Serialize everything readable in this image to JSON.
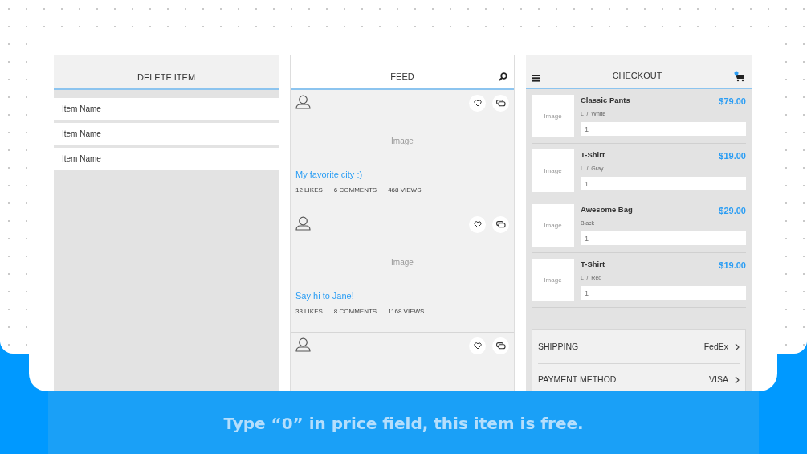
{
  "delete_screen": {
    "title": "DELETE ITEM",
    "items": [
      {
        "label": "Item Name"
      },
      {
        "label": "Item Name"
      },
      {
        "label": "Item Name"
      }
    ]
  },
  "feed_screen": {
    "title": "FEED",
    "posts": [
      {
        "kind": "full",
        "image_label": "Image",
        "caption": "My favorite city :)",
        "likes": "12 LIKES",
        "comments": "6 COMMENTS",
        "views": "468 VIEWS"
      },
      {
        "kind": "full",
        "image_label": "Image",
        "caption": "Say hi to Jane!",
        "likes": "33 LIKES",
        "comments": "8 COMMENTS",
        "views": "1168 VIEWS"
      },
      {
        "kind": "cut_off"
      }
    ]
  },
  "checkout_screen": {
    "title": "CHECKOUT",
    "items": [
      {
        "image_label": "Image",
        "name": "Classic Pants",
        "price": "$79.00",
        "variant": "L  /  White",
        "quantity": "1"
      },
      {
        "image_label": "Image",
        "name": "T-Shirt",
        "price": "$19.00",
        "variant": "L  /  Gray",
        "quantity": "1"
      },
      {
        "image_label": "Image",
        "name": "Awesome Bag",
        "price": "$29.00",
        "variant": "Black",
        "quantity": "1"
      },
      {
        "image_label": "Image",
        "name": "T-Shirt",
        "price": "$19.00",
        "variant": "L  /  Red",
        "quantity": "1"
      }
    ],
    "options": [
      {
        "label": "SHIPPING",
        "value": "FedEx"
      },
      {
        "label": "PAYMENT METHOD",
        "value": "VISA"
      }
    ]
  },
  "caption": "Type “0” in price field, this item is free."
}
